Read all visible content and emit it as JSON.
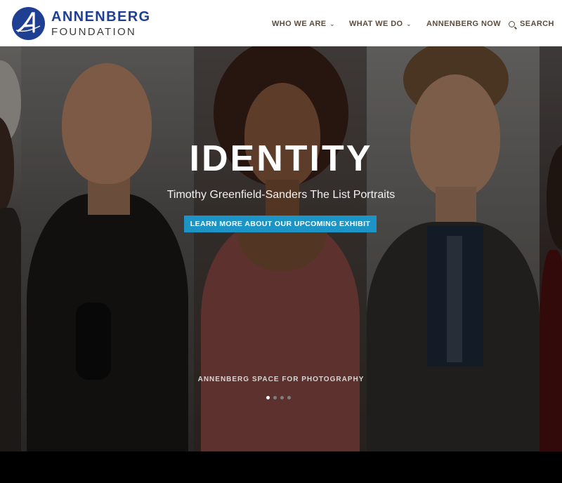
{
  "brand": {
    "name_line1": "ANNENBERG",
    "name_line2": "FOUNDATION",
    "mark_color": "#1f3f93"
  },
  "nav": {
    "items": [
      {
        "label": "WHO WE ARE",
        "has_dropdown": true
      },
      {
        "label": "WHAT WE DO",
        "has_dropdown": true
      },
      {
        "label": "ANNENBERG NOW",
        "has_dropdown": false
      }
    ],
    "search_label": "SEARCH",
    "search_icon": "search-icon",
    "dropdown_icon": "chevron-down-icon"
  },
  "hero": {
    "title": "IDENTITY",
    "subtitle": "Timothy Greenfield-Sanders The List Portraits",
    "cta_label": "LEARN MORE ABOUT OUR UPCOMING EXHIBIT",
    "caption": "ANNENBERG SPACE FOR PHOTOGRAPHY",
    "carousel": {
      "total_slides": 4,
      "active_slide": 1
    },
    "cta_color": "#1c94c6"
  }
}
